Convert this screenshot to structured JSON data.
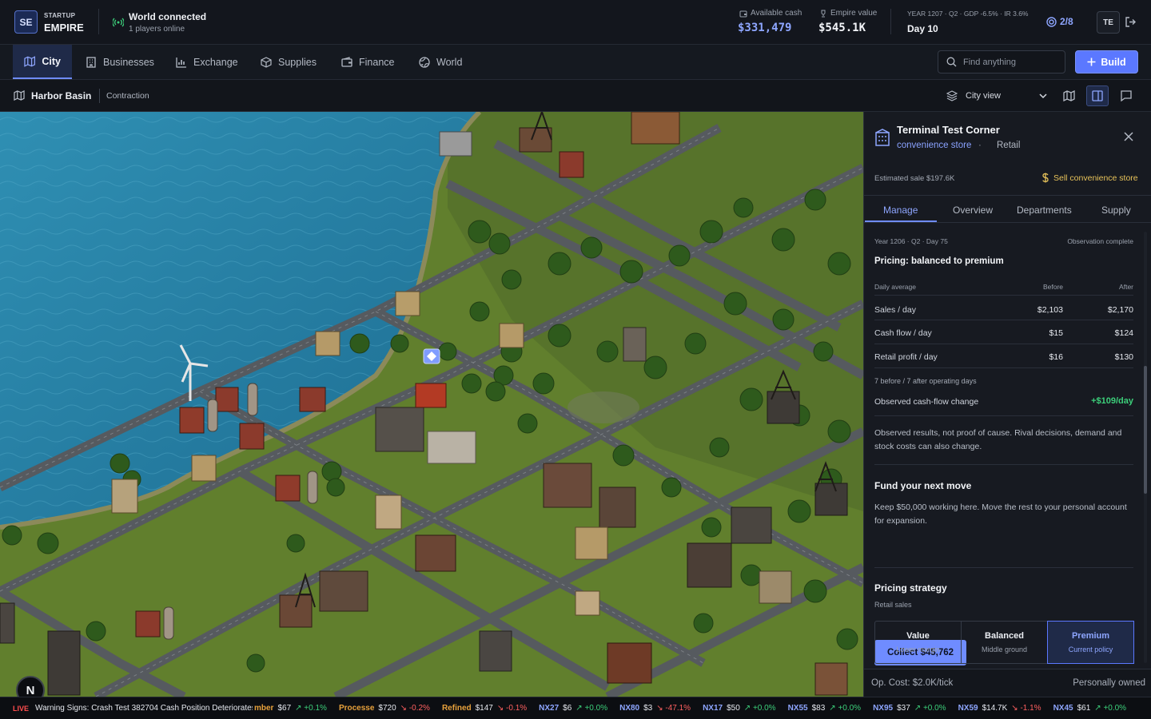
{
  "brand": {
    "logo": "SE",
    "small": "STARTUP",
    "big": "EMPIRE"
  },
  "connection": {
    "title": "World connected",
    "subtitle": "1 players online"
  },
  "stats": {
    "cash_label": "Available cash",
    "cash_value": "$331,479",
    "empire_label": "Empire value",
    "empire_value": "$545.1K",
    "economy": "YEAR 1207 · Q2 · GDP -6.5% · IR 3.6%",
    "day": "Day 10",
    "players": "2/8",
    "avatar": "TE"
  },
  "nav": {
    "tabs": [
      {
        "label": "City",
        "icon": "map-icon"
      },
      {
        "label": "Businesses",
        "icon": "building-icon"
      },
      {
        "label": "Exchange",
        "icon": "chart-icon"
      },
      {
        "label": "Supplies",
        "icon": "box-icon"
      },
      {
        "label": "Finance",
        "icon": "wallet-icon"
      },
      {
        "label": "World",
        "icon": "globe-icon"
      }
    ],
    "search_placeholder": "Find anything",
    "build_label": "Build"
  },
  "subbar": {
    "region": "Harbor Basin",
    "status": "Contraction",
    "view": "City view"
  },
  "panel": {
    "name": "Terminal Test Corner",
    "type": "convenience store",
    "separator": "·",
    "category": "Retail",
    "estimated_sale": "Estimated sale $197.6K",
    "sell_label": "Sell convenience store",
    "tabs": [
      "Manage",
      "Overview",
      "Departments",
      "Supply"
    ],
    "observation": {
      "date": "Year 1206 · Q2 · Day 75",
      "status": "Observation complete",
      "title": "Pricing: balanced to premium",
      "col_label": "Daily average",
      "col_before": "Before",
      "col_after": "After",
      "metrics": [
        {
          "label": "Sales / day",
          "before": "$2,103",
          "after": "$2,170"
        },
        {
          "label": "Cash flow / day",
          "before": "$15",
          "after": "$124"
        },
        {
          "label": "Retail profit / day",
          "before": "$16",
          "after": "$130"
        }
      ],
      "days_note": "7 before / 7 after operating days",
      "change_label": "Observed cash-flow change",
      "change_value": "+$109/day",
      "note": "Observed results, not proof of cause. Rival decisions, demand and stock costs can also change."
    },
    "fund": {
      "title": "Fund your next move",
      "desc": "Keep $50,000 working here. Move the rest to your personal account for expansion.",
      "button": "Collect $45,762"
    },
    "pricing": {
      "title": "Pricing strategy",
      "sub": "Retail sales",
      "options": [
        {
          "name": "Value",
          "desc": "Lower margin",
          "selected": false
        },
        {
          "name": "Balanced",
          "desc": "Middle ground",
          "selected": false
        },
        {
          "name": "Premium",
          "desc": "Current policy",
          "selected": true
        }
      ]
    },
    "footer": {
      "op_cost": "Op. Cost: $2.0K/tick",
      "ownership": "Personally owned"
    }
  },
  "ticker": {
    "live": "LIVE",
    "headline": "Warning Signs: Crash Test 382704 Cash Position Deteriorates",
    "items": [
      {
        "sym": "mber",
        "price": "$67",
        "chg": "+0.1%",
        "dir": "up",
        "color": "#e8a23c"
      },
      {
        "sym": "Processe",
        "price": "$720",
        "chg": "-0.2%",
        "dir": "down",
        "color": "#e8a23c"
      },
      {
        "sym": "Refined",
        "price": "$147",
        "chg": "-0.1%",
        "dir": "down",
        "color": "#e8a23c"
      },
      {
        "sym": "NX27",
        "price": "$6",
        "chg": "+0.0%",
        "dir": "up",
        "color": "#8ea6ff"
      },
      {
        "sym": "NX80",
        "price": "$3",
        "chg": "-47.1%",
        "dir": "down",
        "color": "#8ea6ff"
      },
      {
        "sym": "NX17",
        "price": "$50",
        "chg": "+0.0%",
        "dir": "up",
        "color": "#8ea6ff"
      },
      {
        "sym": "NX55",
        "price": "$83",
        "chg": "+0.0%",
        "dir": "up",
        "color": "#8ea6ff"
      },
      {
        "sym": "NX95",
        "price": "$37",
        "chg": "+0.0%",
        "dir": "up",
        "color": "#8ea6ff"
      },
      {
        "sym": "NX59",
        "price": "$14.7K",
        "chg": "-1.1%",
        "dir": "down",
        "color": "#8ea6ff"
      },
      {
        "sym": "NX45",
        "price": "$61",
        "chg": "+0.0%",
        "dir": "up",
        "color": "#8ea6ff"
      }
    ]
  },
  "map": {
    "badge": "N"
  },
  "colors": {
    "accent": "#6f8cff",
    "positive": "#3ccf7a",
    "negative": "#ff6060",
    "warning": "#e8c35a"
  }
}
